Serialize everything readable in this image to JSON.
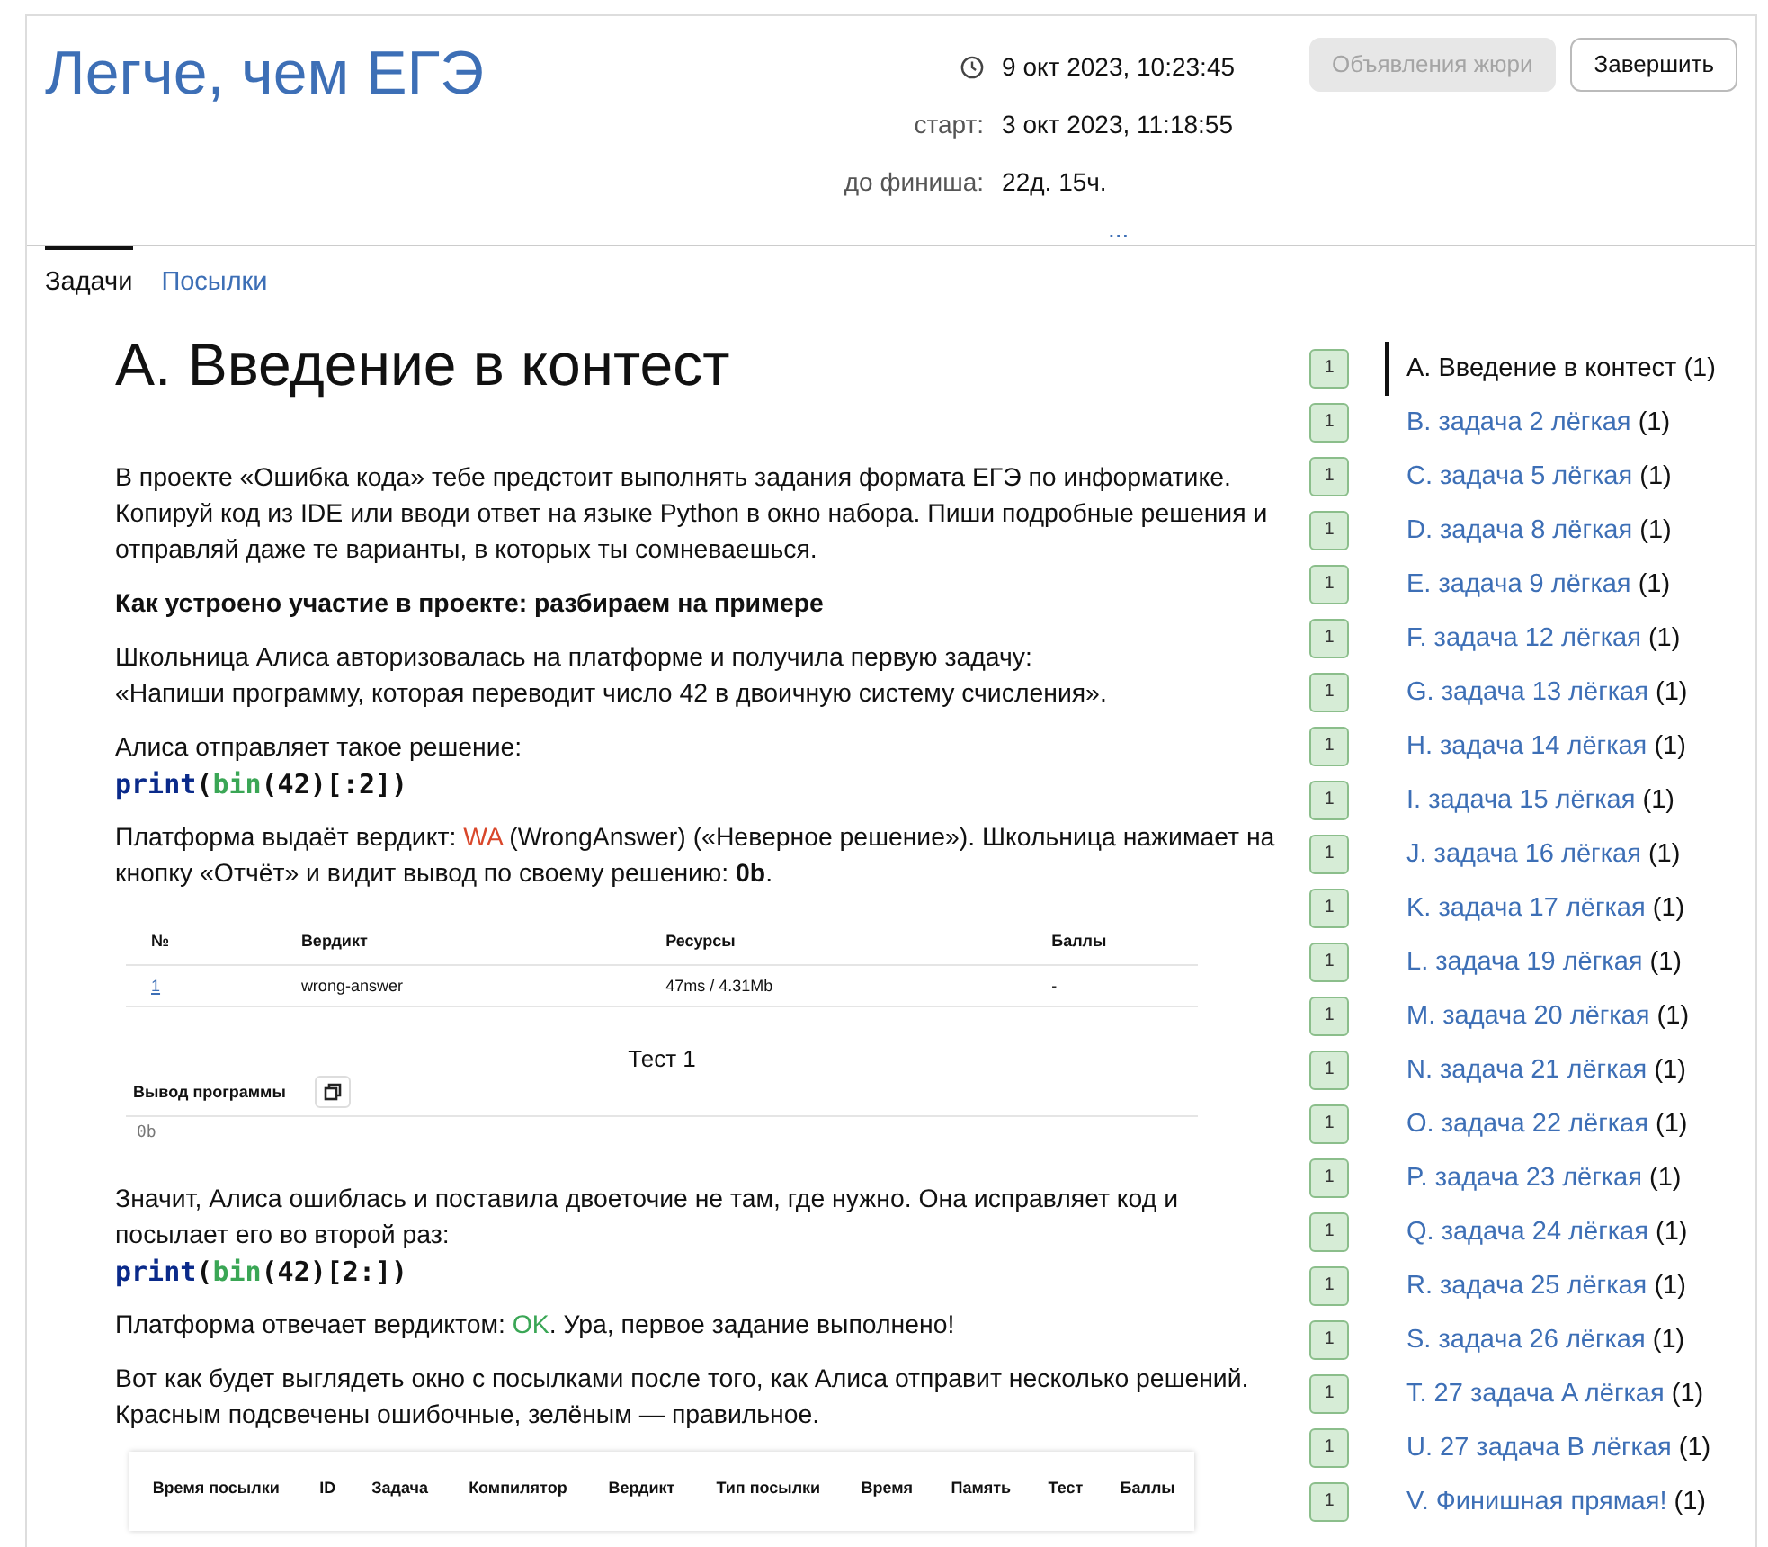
{
  "header": {
    "title": "Легче, чем ЕГЭ",
    "clock": "9 окт 2023, 10:23:45",
    "info": [
      {
        "label": "старт:",
        "value": "3 окт 2023, 11:18:55"
      },
      {
        "label": "до финиша:",
        "value": "22д. 15ч."
      }
    ],
    "more": "...",
    "buttons": [
      {
        "label": "Объявления жюри",
        "disabled": true
      },
      {
        "label": "Завершить",
        "disabled": false
      }
    ]
  },
  "tabs": [
    {
      "label": "Задачи",
      "selected": true
    },
    {
      "label": "Посылки",
      "selected": false
    }
  ],
  "problem": {
    "title": "A. Введение в контест",
    "blocks": [
      {
        "kind": "paragraph",
        "segments": [
          {
            "text": "В проекте «Ошибка кода» тебе предстоит выполнять задания формата ЕГЭ по информатике. Копируй код из IDE или вводи ответ на языке Python в окно набора. Пиши подробные решения и отправляй даже те варианты, в которых ты сомневаешься."
          }
        ]
      },
      {
        "kind": "heading",
        "text": "Как устроено участие в проекте: разбираем на примере"
      },
      {
        "kind": "paragraph",
        "segments": [
          {
            "text": "Школьница Алиса авторизовалась на платформе и получила первую задачу:\n«Напиши программу, которая переводит число 42 в двоичную систему счисления»."
          }
        ]
      },
      {
        "kind": "paragraph_code",
        "segments": [
          {
            "text": "Алиса отправляет такое решение:"
          }
        ],
        "code": [
          {
            "kind": "keyword",
            "text": "print"
          },
          {
            "kind": "plain",
            "text": "("
          },
          {
            "kind": "builtin",
            "text": "bin"
          },
          {
            "kind": "plain",
            "text": "(42)[:2])"
          }
        ]
      },
      {
        "kind": "paragraph",
        "segments": [
          {
            "text": "Платформа выдаёт вердикт: "
          },
          {
            "text": "WA",
            "color": "#d9472b"
          },
          {
            "text": " (WrongAnswer) («Неверное решение»). Школьница нажимает на кнопку «Отчёт» и видит вывод по своему решению: **0b**."
          }
        ]
      },
      {
        "kind": "test_report",
        "columns": [
          "№",
          "Вердикт",
          "Ресурсы",
          "Баллы"
        ],
        "row": [
          "1",
          "wrong-answer",
          "47ms / 4.31Mb",
          "-"
        ],
        "test_title": "Тест 1",
        "output_label": "Вывод программы",
        "output": "0b"
      },
      {
        "kind": "paragraph_code",
        "segments": [
          {
            "text": "Значит, Алиса ошиблась и поставила двоеточие не там, где нужно. Она исправляет код и посылает его во второй раз:"
          }
        ],
        "code": [
          {
            "kind": "keyword",
            "text": "print"
          },
          {
            "kind": "plain",
            "text": "("
          },
          {
            "kind": "builtin",
            "text": "bin"
          },
          {
            "kind": "plain",
            "text": "(42)[2:])"
          }
        ]
      },
      {
        "kind": "paragraph",
        "segments": [
          {
            "text": "Платформа отвечает вердиктом: "
          },
          {
            "text": "OK",
            "color": "#3aa655"
          },
          {
            "text": ". Ура, первое задание выполнено!"
          }
        ]
      },
      {
        "kind": "paragraph",
        "segments": [
          {
            "text": "Вот как будет выглядеть окно с посылками после того, как Алиса отправит несколько решений. Красным подсвечены ошибочные, зелёным — правильное."
          }
        ]
      },
      {
        "kind": "submissions_table",
        "columns": [
          "Время посылки",
          "ID",
          "Задача",
          "Компилятор",
          "Вердикт",
          "Тип посылки",
          "Время",
          "Память",
          "Тест",
          "Баллы"
        ]
      }
    ]
  },
  "problems": [
    {
      "name": "A. Введение в контест",
      "count": "(1)",
      "badge": "1",
      "selected": true
    },
    {
      "name": "B. задача 2 лёгкая",
      "count": "(1)",
      "badge": "1",
      "selected": false
    },
    {
      "name": "C. задача 5 лёгкая",
      "count": "(1)",
      "badge": "1",
      "selected": false
    },
    {
      "name": "D. задача 8 лёгкая",
      "count": "(1)",
      "badge": "1",
      "selected": false
    },
    {
      "name": "E. задача 9 лёгкая",
      "count": "(1)",
      "badge": "1",
      "selected": false
    },
    {
      "name": "F. задача 12 лёгкая",
      "count": "(1)",
      "badge": "1",
      "selected": false
    },
    {
      "name": "G. задача 13 лёгкая",
      "count": "(1)",
      "badge": "1",
      "selected": false
    },
    {
      "name": "H. задача 14 лёгкая",
      "count": "(1)",
      "badge": "1",
      "selected": false
    },
    {
      "name": "I. задача 15 лёгкая",
      "count": "(1)",
      "badge": "1",
      "selected": false
    },
    {
      "name": "J. задача 16 лёгкая",
      "count": "(1)",
      "badge": "1",
      "selected": false
    },
    {
      "name": "K. задача 17 лёгкая",
      "count": "(1)",
      "badge": "1",
      "selected": false
    },
    {
      "name": "L. задача 19 лёгкая",
      "count": "(1)",
      "badge": "1",
      "selected": false
    },
    {
      "name": "M. задача 20 лёгкая",
      "count": "(1)",
      "badge": "1",
      "selected": false
    },
    {
      "name": "N. задача 21 лёгкая",
      "count": "(1)",
      "badge": "1",
      "selected": false
    },
    {
      "name": "O. задача 22 лёгкая",
      "count": "(1)",
      "badge": "1",
      "selected": false
    },
    {
      "name": "P. задача 23 лёгкая",
      "count": "(1)",
      "badge": "1",
      "selected": false
    },
    {
      "name": "Q. задача 24 лёгкая",
      "count": "(1)",
      "badge": "1",
      "selected": false
    },
    {
      "name": "R. задача 25 лёгкая",
      "count": "(1)",
      "badge": "1",
      "selected": false
    },
    {
      "name": "S. задача 26 лёгкая",
      "count": "(1)",
      "badge": "1",
      "selected": false
    },
    {
      "name": "T. 27 задача A лёгкая",
      "count": "(1)",
      "badge": "1",
      "selected": false
    },
    {
      "name": "U. 27 задача B лёгкая",
      "count": "(1)",
      "badge": "1",
      "selected": false
    },
    {
      "name": "V. Финишная прямая!",
      "count": "(1)",
      "badge": "1",
      "selected": false
    }
  ]
}
